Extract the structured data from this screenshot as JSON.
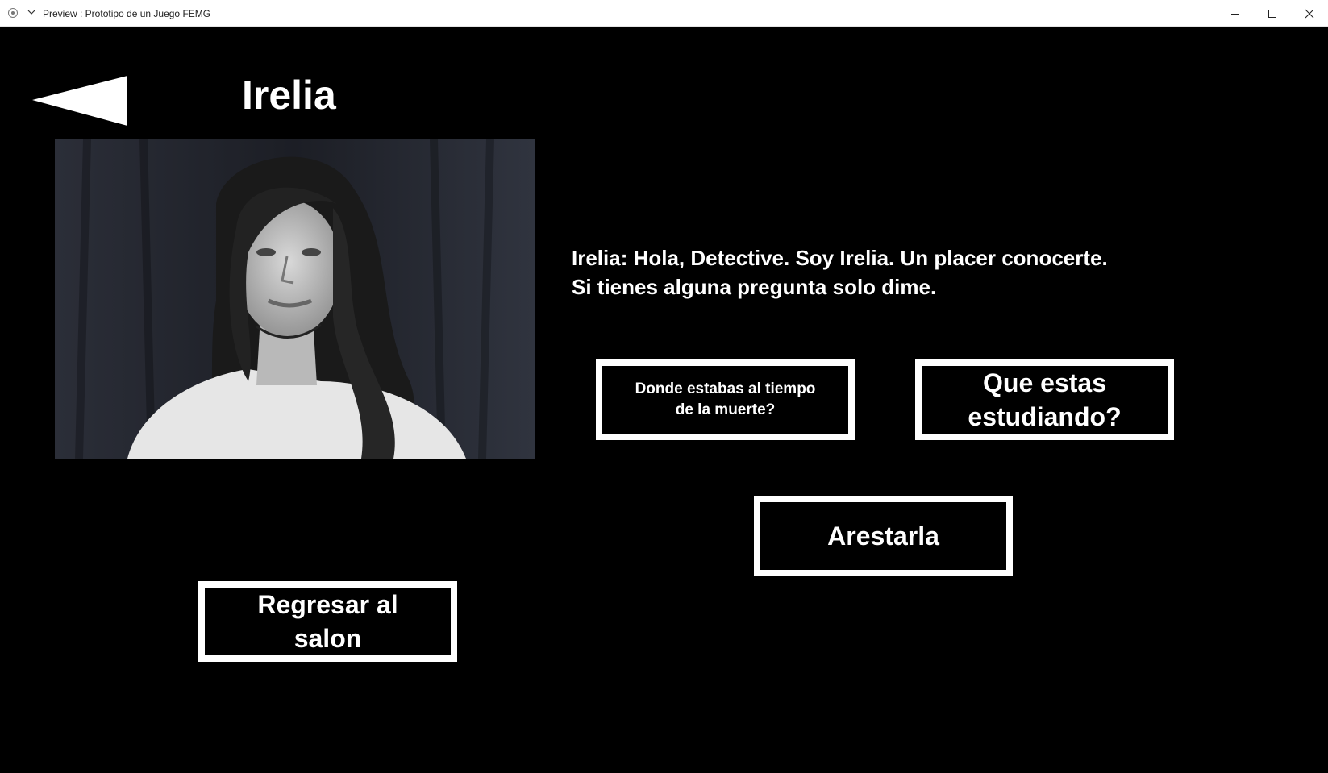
{
  "window": {
    "title": "Preview : Prototipo de un Juego FEMG",
    "controls": {
      "minimize_icon": "minimize-icon",
      "maximize_icon": "maximize-icon",
      "close_icon": "close-icon"
    }
  },
  "scene": {
    "character_name": "Irelia",
    "back_icon": "back-arrow-icon",
    "portrait_icon": "character-portrait",
    "dialogue": {
      "line1": "Irelia: Hola, Detective. Soy Irelia. Un placer conocerte.",
      "line2": "Si tienes alguna pregunta solo dime."
    },
    "choices": {
      "donde": "Donde estabas al tiempo de la muerte?",
      "que": "Que estas estudiando?",
      "arrest": "Arestarla",
      "regresar": "Regresar al salon"
    }
  },
  "colors": {
    "background": "#000000",
    "foreground": "#ffffff"
  }
}
